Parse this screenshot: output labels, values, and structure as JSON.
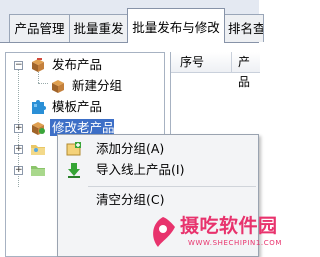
{
  "tabs": [
    {
      "label": "产品管理",
      "active": false
    },
    {
      "label": "批量重发",
      "active": false
    },
    {
      "label": "批量发布与修改",
      "active": true
    },
    {
      "label": "排名查",
      "active": false
    }
  ],
  "tree": {
    "items": [
      {
        "label": "发布产品",
        "icon": "box-icon",
        "expanded": true
      },
      {
        "label": "新建分组",
        "icon": "box-icon"
      },
      {
        "label": "模板产品",
        "icon": "puzzle-icon"
      },
      {
        "label": "修改老产品",
        "icon": "box-tools-icon",
        "selected": true
      },
      {
        "label": "",
        "icon": "folder-icon"
      },
      {
        "label": "",
        "icon": "folder-icon"
      }
    ]
  },
  "list": {
    "columns": [
      "序号",
      "产品"
    ]
  },
  "context_menu": {
    "items": [
      {
        "label": "添加分组(A)",
        "icon": "add-group-icon"
      },
      {
        "label": "导入线上产品(I)",
        "icon": "import-arrow-icon"
      },
      {
        "label": "清空分组(C)",
        "icon": ""
      }
    ]
  },
  "watermark": {
    "text": "摄吃软件园",
    "url": "WWW.SHECHIPIN1.COM"
  },
  "colors": {
    "selection": "#3d6fc7",
    "watermark": "#e8336d"
  }
}
